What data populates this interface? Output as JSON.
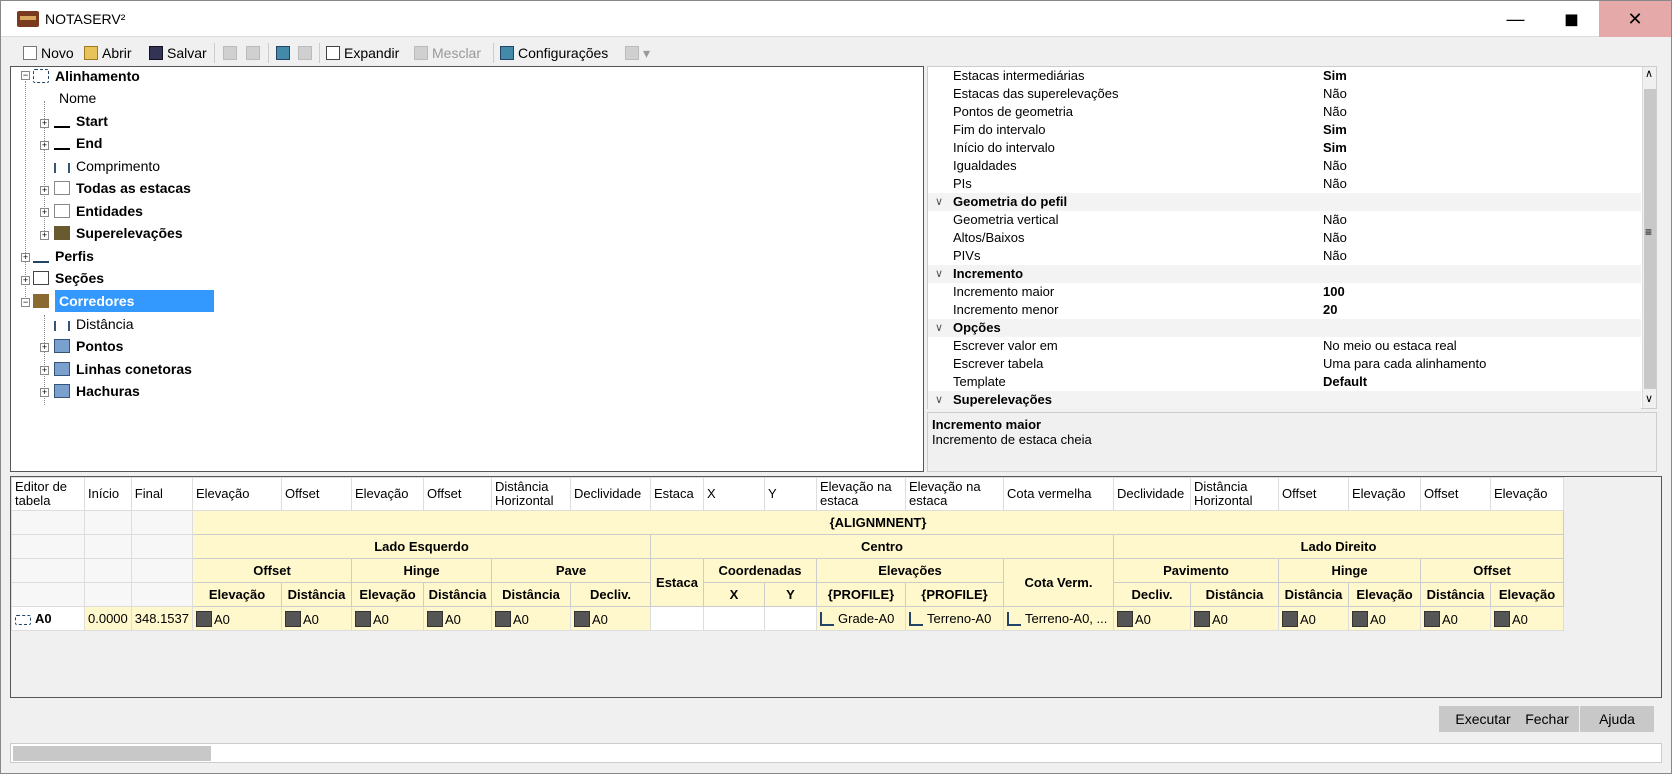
{
  "window": {
    "title": "NOTASERV²",
    "min": "—",
    "max": "◼",
    "close": "✕"
  },
  "toolbar": {
    "novo": "Novo",
    "abrir": "Abrir",
    "salvar": "Salvar",
    "expandir": "Expandir",
    "mesclar": "Mesclar",
    "config": "Configurações",
    "dropdown": "▾"
  },
  "tree": {
    "alinhamento": "Alinhamento",
    "nome": "Nome",
    "start": "Start",
    "end": "End",
    "comprimento": "Comprimento",
    "todas": "Todas as estacas",
    "entidades": "Entidades",
    "superelevacoes": "Superelevações",
    "perfis": "Perfis",
    "secoes": "Seções",
    "corredores": "Corredores",
    "distancia": "Distância",
    "pontos": "Pontos",
    "linhas": "Linhas conetoras",
    "hachuras": "Hachuras"
  },
  "props": {
    "rows": [
      {
        "k": "Estacas intermediárias",
        "v": "Sim",
        "b": true
      },
      {
        "k": "Estacas das superelevações",
        "v": "Não"
      },
      {
        "k": "Pontos de geometria",
        "v": "Não"
      },
      {
        "k": "Fim do intervalo",
        "v": "Sim",
        "b": true
      },
      {
        "k": "Início do intervalo",
        "v": "Sim",
        "b": true
      },
      {
        "k": "Igualdades",
        "v": "Não"
      },
      {
        "k": "PIs",
        "v": "Não"
      },
      {
        "cat": "Geometria do pefil"
      },
      {
        "k": "Geometria vertical",
        "v": "Não"
      },
      {
        "k": "Altos/Baixos",
        "v": "Não"
      },
      {
        "k": "PIVs",
        "v": "Não"
      },
      {
        "cat": "Incremento"
      },
      {
        "k": "Incremento maior",
        "v": "100",
        "b": true
      },
      {
        "k": "Incremento menor",
        "v": "20",
        "b": true
      },
      {
        "cat": "Opções"
      },
      {
        "k": "Escrever valor em",
        "v": "No meio ou estaca real"
      },
      {
        "k": "Escrever tabela",
        "v": "Uma para cada alinhamento"
      },
      {
        "k": "Template",
        "v": "Default",
        "b": true
      },
      {
        "cat": "Superelevações"
      }
    ],
    "chevron": "∨",
    "scroll_up": "∧",
    "scroll_down": "∨",
    "scroll_grip": "≡"
  },
  "desc": {
    "title": "Incremento maior",
    "text": "Incremento de estaca cheia"
  },
  "grid": {
    "headers": [
      "Editor de tabela",
      "Início",
      "Final",
      "Elevação",
      "Offset",
      "Elevação",
      "Offset",
      "Distância Horizontal",
      "Declividade",
      "Estaca",
      "X",
      "Y",
      "Elevação na estaca",
      "Elevação na estaca",
      "Cota vermelha",
      "Declividade",
      "Distância Horizontal",
      "Offset",
      "Elevação",
      "Offset",
      "Elevação"
    ],
    "alignment": "{ALIGNMNENT}",
    "lado_esq": "Lado Esquerdo",
    "centro": "Centro",
    "lado_dir": "Lado Direito",
    "g_offset": "Offset",
    "g_hinge": "Hinge",
    "g_pave": "Pave",
    "g_estaca": "Estaca",
    "g_coord": "Coordenadas",
    "g_elev": "Elevações",
    "g_cota": "Cota Verm.",
    "g_pav": "Pavimento",
    "g_hinge2": "Hinge",
    "g_offset2": "Offset",
    "s": [
      "Elevação",
      "Distância",
      "Elevação",
      "Distância",
      "Distância",
      "Decliv.",
      "X",
      "Y",
      "{PROFILE}",
      "{PROFILE}",
      "Decliv.",
      "Distância",
      "Distância",
      "Elevação",
      "Distância",
      "Elevação"
    ],
    "row": {
      "name": "A0",
      "inicio": "0.0000",
      "final": "348.1537",
      "a": "A0",
      "grade": "Grade-A0",
      "terreno": "Terreno-A0",
      "cota": "Terreno-A0, ..."
    }
  },
  "buttons": {
    "executar": "Executar",
    "fechar": "Fechar",
    "ajuda": "Ajuda"
  }
}
